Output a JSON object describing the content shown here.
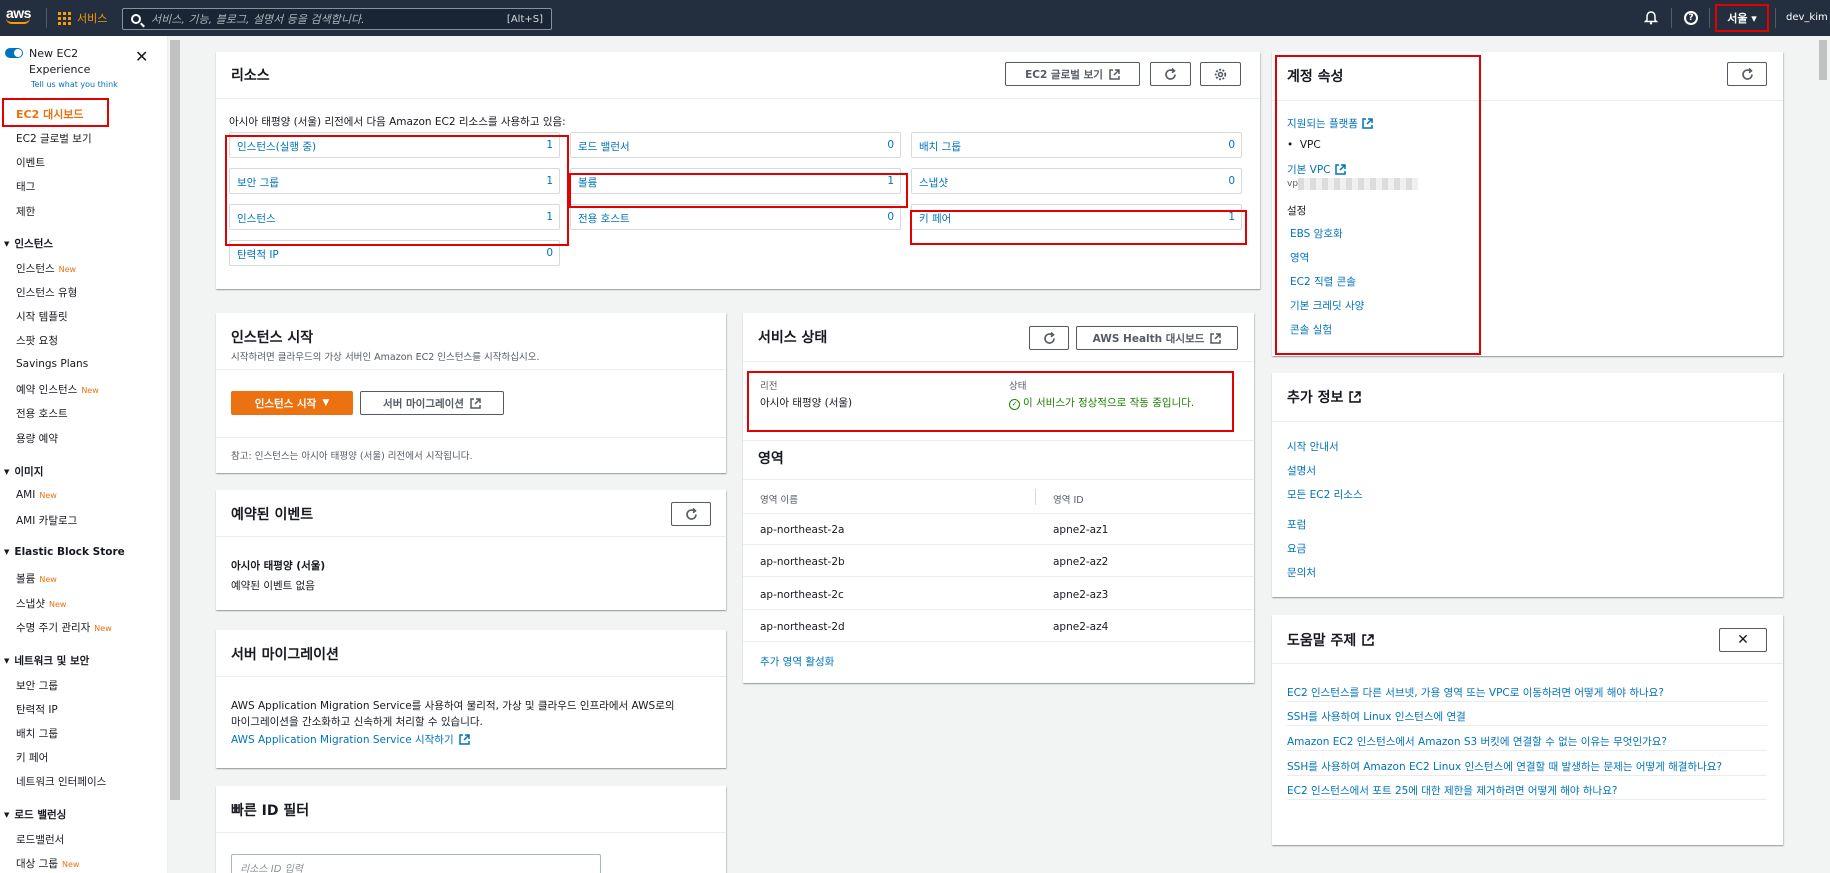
{
  "topnav": {
    "logo": "aws",
    "services": "서비스",
    "search_placeholder": "서비스, 기능, 블로그, 설명서 등을 검색합니다.",
    "search_shortcut": "[Alt+S]",
    "region": "서울 ▾",
    "user": "dev_kim ▾"
  },
  "sidebar": {
    "new_experience": "New EC2 Experience",
    "tell_us": "Tell us what you think",
    "dashboard": "EC2 대시보드",
    "items_top": [
      "EC2 글로벌 보기",
      "이벤트",
      "태그",
      "제한"
    ],
    "groups": [
      {
        "title": "인스턴스",
        "items": [
          {
            "label": "인스턴스",
            "badge": "New"
          },
          {
            "label": "인스턴스 유형",
            "badge": ""
          },
          {
            "label": "시작 템플릿",
            "badge": ""
          },
          {
            "label": "스팟 요청",
            "badge": ""
          },
          {
            "label": "Savings Plans",
            "badge": ""
          },
          {
            "label": "예약 인스턴스",
            "badge": "New"
          },
          {
            "label": "전용 호스트",
            "badge": ""
          },
          {
            "label": "용량 예약",
            "badge": ""
          }
        ]
      },
      {
        "title": "이미지",
        "items": [
          {
            "label": "AMI",
            "badge": "New"
          },
          {
            "label": "AMI 카탈로그",
            "badge": ""
          }
        ]
      },
      {
        "title": "Elastic Block Store",
        "items": [
          {
            "label": "볼륨",
            "badge": "New"
          },
          {
            "label": "스냅샷",
            "badge": "New"
          },
          {
            "label": "수명 주기 관리자",
            "badge": "New"
          }
        ]
      },
      {
        "title": "네트워크 및 보안",
        "items": [
          {
            "label": "보안 그룹",
            "badge": ""
          },
          {
            "label": "탄력적 IP",
            "badge": ""
          },
          {
            "label": "배치 그룹",
            "badge": ""
          },
          {
            "label": "키 페어",
            "badge": ""
          },
          {
            "label": "네트워크 인터페이스",
            "badge": ""
          }
        ]
      },
      {
        "title": "로드 밸런싱",
        "items": [
          {
            "label": "로드밸런서",
            "badge": ""
          },
          {
            "label": "대상 그룹",
            "badge": "New"
          }
        ]
      }
    ]
  },
  "resources": {
    "title": "리소스",
    "global_view_btn": "EC2 글로벌 보기",
    "desc": "아시아 태평양 (서울) 리전에서 다음 Amazon EC2 리소스를 사용하고 있음:",
    "cells": [
      {
        "label": "인스턴스(실행 중)",
        "count": "1"
      },
      {
        "label": "로드 밸런서",
        "count": "0"
      },
      {
        "label": "배치 그룹",
        "count": "0"
      },
      {
        "label": "보안 그룹",
        "count": "1"
      },
      {
        "label": "볼륨",
        "count": "1"
      },
      {
        "label": "스냅샷",
        "count": "0"
      },
      {
        "label": "인스턴스",
        "count": "1"
      },
      {
        "label": "전용 호스트",
        "count": "0"
      },
      {
        "label": "키 페어",
        "count": "1"
      },
      {
        "label": "탄력적 IP",
        "count": "0"
      }
    ]
  },
  "launch": {
    "title": "인스턴스 시작",
    "desc": "시작하려면 클라우드의 가상 서버인 Amazon EC2 인스턴스를 시작하십시오.",
    "launch_btn": "인스턴스 시작",
    "migrate_btn": "서버 마이그레이션",
    "note": "참고: 인스턴스는 아시아 태평양 (서울) 리전에서 시작됩니다."
  },
  "events": {
    "title": "예약된 이벤트",
    "region": "아시아 태평양 (서울)",
    "none": "예약된 이벤트 없음"
  },
  "migration": {
    "title": "서버 마이그레이션",
    "desc1": "AWS Application Migration Service를 사용하여 물리적, 가상 및 클라우드 인프라에서 AWS로의",
    "desc2": "마이그레이션을 간소화하고 신속하게 처리할 수 있습니다.",
    "link": "AWS Application Migration Service 시작하기"
  },
  "quickid": {
    "title": "빠른 ID 필터",
    "placeholder": "리소스 ID 입력"
  },
  "health": {
    "title": "서비스 상태",
    "dashboard_btn": "AWS Health 대시보드",
    "region_label": "리전",
    "region_value": "아시아 태평양 (서울)",
    "status_label": "상태",
    "status_value": "이 서비스가 정상적으로 작동 중입니다."
  },
  "zones": {
    "title": "영역",
    "col_name": "영역 이름",
    "col_id": "영역 ID",
    "rows": [
      {
        "name": "ap-northeast-2a",
        "id": "apne2-az1"
      },
      {
        "name": "ap-northeast-2b",
        "id": "apne2-az2"
      },
      {
        "name": "ap-northeast-2c",
        "id": "apne2-az3"
      },
      {
        "name": "ap-northeast-2d",
        "id": "apne2-az4"
      }
    ],
    "enable_more": "추가 영역 활성화"
  },
  "account": {
    "title": "계정 속성",
    "supported_platforms": "지원되는 플랫폼",
    "vpc_bullet": "VPC",
    "default_vpc": "기본 VPC",
    "vpc_id_prefix": "vp",
    "settings": "설정",
    "settings_items": [
      "EBS 암호화",
      "영역",
      "EC2 직렬 콘솔",
      "기본 크레딧 사양",
      "콘솔 실험"
    ]
  },
  "extra": {
    "title": "추가 정보",
    "links_a": [
      "시작 안내서",
      "설명서",
      "모든 EC2 리소스"
    ],
    "links_b": [
      "포럼",
      "요금",
      "문의처"
    ]
  },
  "helptopics": {
    "title": "도움말 주제",
    "links": [
      "EC2 인스턴스를 다른 서브넷, 가용 영역 또는 VPC로 이동하려면 어떻게 해야 하나요?",
      "SSH를 사용하여 Linux 인스턴스에 연결",
      "Amazon EC2 인스턴스에서 Amazon S3 버킷에 연결할 수 없는 이유는 무엇인가요?",
      "SSH를 사용하여 Amazon EC2 Linux 인스턴스에 연결할 때 발생하는 문제는 어떻게 해결하나요?",
      "EC2 인스턴스에서 포트 25에 대한 제한을 제거하려면 어떻게 해야 하나요?"
    ]
  },
  "colors": {
    "nav_bg": "#232f3e",
    "accent": "#ec7211",
    "link": "#0073bb",
    "highlight": "#e40000",
    "success": "#1d8102"
  }
}
